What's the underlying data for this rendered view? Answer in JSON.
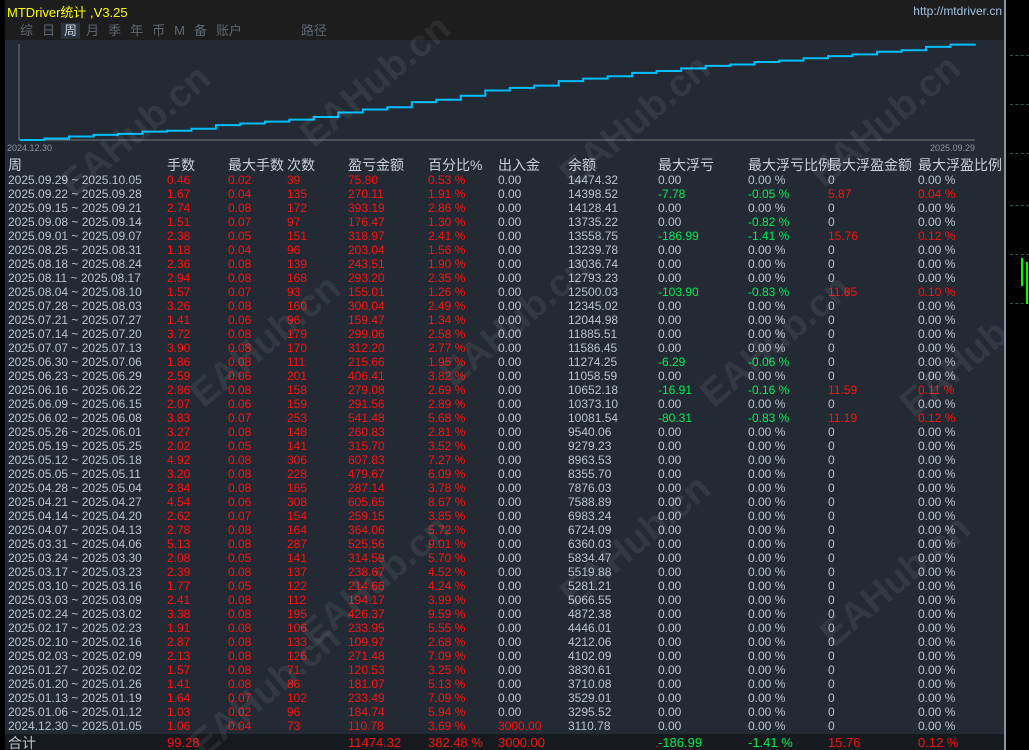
{
  "window": {
    "title": "MTDriver统计 ,V3.25",
    "url": "http://mtdriver.cn"
  },
  "tabs": [
    {
      "label": "综"
    },
    {
      "label": "日"
    },
    {
      "label": "周",
      "active": true
    },
    {
      "label": "月"
    },
    {
      "label": "季"
    },
    {
      "label": "年"
    },
    {
      "label": "币"
    },
    {
      "label": "M"
    },
    {
      "label": "备"
    },
    {
      "label": "账户"
    },
    {
      "label": "路径"
    }
  ],
  "equity_chart": {
    "start_label": "2024.12.30",
    "end_label": "2025.09.29",
    "line_color": "#00bfff"
  },
  "watermark": "EAHub.cn",
  "colors": {
    "positive": "#ff1010",
    "negative": "#00ee55",
    "text": "#b8c4d2"
  },
  "table": {
    "headers": [
      "周",
      "手数",
      "最大手数",
      "次数",
      "盈亏金额",
      "百分比%",
      "出入金",
      "余额",
      "最大浮亏",
      "最大浮亏比例",
      "最大浮盈金额",
      "最大浮盈比例"
    ],
    "rows": [
      [
        "2025.09.29 ~ 2025.10.05",
        "0.46",
        "0.02",
        "39",
        "75.80",
        "0.53 %",
        "0.00",
        "14474.32",
        "0.00",
        "0.00 %",
        "0",
        "0.00 %"
      ],
      [
        "2025.09.22 ~ 2025.09.28",
        "1.67",
        "0.04",
        "135",
        "270.11",
        "1.91 %",
        "0.00",
        "14398.52",
        "-7.78",
        "-0.05 %",
        "5.87",
        "0.04 %"
      ],
      [
        "2025.09.15 ~ 2025.09.21",
        "2.74",
        "0.08",
        "172",
        "393.19",
        "2.86 %",
        "0.00",
        "14128.41",
        "0.00",
        "0.00 %",
        "0",
        "0.00 %"
      ],
      [
        "2025.09.08 ~ 2025.09.14",
        "1.51",
        "0.07",
        "97",
        "176.47",
        "1.30 %",
        "0.00",
        "13735.22",
        "0.00",
        "-0.82 %",
        "0",
        "0.00 %"
      ],
      [
        "2025.09.01 ~ 2025.09.07",
        "2.38",
        "0.05",
        "151",
        "318.97",
        "2.41 %",
        "0.00",
        "13558.75",
        "-186.99",
        "-1.41 %",
        "15.76",
        "0.12 %"
      ],
      [
        "2025.08.25 ~ 2025.08.31",
        "1.18",
        "0.04",
        "96",
        "203.04",
        "1.56 %",
        "0.00",
        "13239.78",
        "0.00",
        "0.00 %",
        "0",
        "0.00 %"
      ],
      [
        "2025.08.18 ~ 2025.08.24",
        "2.36",
        "0.08",
        "139",
        "243.51",
        "1.90 %",
        "0.00",
        "13036.74",
        "0.00",
        "0.00 %",
        "0",
        "0.00 %"
      ],
      [
        "2025.08.11 ~ 2025.08.17",
        "2.94",
        "0.08",
        "168",
        "293.20",
        "2.35 %",
        "0.00",
        "12793.23",
        "0.00",
        "0.00 %",
        "0",
        "0.00 %"
      ],
      [
        "2025.08.04 ~ 2025.08.10",
        "1.57",
        "0.07",
        "93",
        "155.01",
        "1.26 %",
        "0.00",
        "12500.03",
        "-103.90",
        "-0.83 %",
        "11.85",
        "0.10 %"
      ],
      [
        "2025.07.28 ~ 2025.08.03",
        "3.26",
        "0.08",
        "160",
        "300.04",
        "2.49 %",
        "0.00",
        "12345.02",
        "0.00",
        "0.00 %",
        "0",
        "0.00 %"
      ],
      [
        "2025.07.21 ~ 2025.07.27",
        "1.41",
        "0.06",
        "96",
        "159.47",
        "1.34 %",
        "0.00",
        "12044.98",
        "0.00",
        "0.00 %",
        "0",
        "0.00 %"
      ],
      [
        "2025.07.14 ~ 2025.07.20",
        "3.72",
        "0.08",
        "179",
        "299.06",
        "2.58 %",
        "0.00",
        "11885.51",
        "0.00",
        "0.00 %",
        "0",
        "0.00 %"
      ],
      [
        "2025.07.07 ~ 2025.07.13",
        "3.90",
        "0.08",
        "170",
        "312.20",
        "2.77 %",
        "0.00",
        "11586.45",
        "0.00",
        "0.00 %",
        "0",
        "0.00 %"
      ],
      [
        "2025.06.30 ~ 2025.07.06",
        "1.86",
        "0.08",
        "111",
        "215.66",
        "1.95 %",
        "0.00",
        "11274.25",
        "-6.29",
        "-0.06 %",
        "0",
        "0.00 %"
      ],
      [
        "2025.06.23 ~ 2025.06.29",
        "2.59",
        "0.06",
        "201",
        "406.41",
        "3.82 %",
        "0.00",
        "11058.59",
        "0.00",
        "0.00 %",
        "0",
        "0.00 %"
      ],
      [
        "2025.06.16 ~ 2025.06.22",
        "2.86",
        "0.08",
        "158",
        "279.08",
        "2.69 %",
        "0.00",
        "10652.18",
        "-16.91",
        "-0.16 %",
        "11.59",
        "0.11 %"
      ],
      [
        "2025.06.09 ~ 2025.06.15",
        "2.07",
        "0.06",
        "159",
        "291.56",
        "2.89 %",
        "0.00",
        "10373.10",
        "0.00",
        "0.00 %",
        "0",
        "0.00 %"
      ],
      [
        "2025.06.02 ~ 2025.06.08",
        "3.83",
        "0.07",
        "253",
        "541.48",
        "5.68 %",
        "0.00",
        "10081.54",
        "-80.31",
        "-0.83 %",
        "11.19",
        "0.12 %"
      ],
      [
        "2025.05.26 ~ 2025.06.01",
        "3.27",
        "0.08",
        "148",
        "260.83",
        "2.81 %",
        "0.00",
        "9540.06",
        "0.00",
        "0.00 %",
        "0",
        "0.00 %"
      ],
      [
        "2025.05.19 ~ 2025.05.25",
        "2.02",
        "0.05",
        "141",
        "315.70",
        "3.52 %",
        "0.00",
        "9279.23",
        "0.00",
        "0.00 %",
        "0",
        "0.00 %"
      ],
      [
        "2025.05.12 ~ 2025.05.18",
        "4.92",
        "0.08",
        "306",
        "607.83",
        "7.27 %",
        "0.00",
        "8963.53",
        "0.00",
        "0.00 %",
        "0",
        "0.00 %"
      ],
      [
        "2025.05.05 ~ 2025.05.11",
        "3.20",
        "0.08",
        "228",
        "479.67",
        "6.09 %",
        "0.00",
        "8355.70",
        "0.00",
        "0.00 %",
        "0",
        "0.00 %"
      ],
      [
        "2025.04.28 ~ 2025.05.04",
        "2.84",
        "0.08",
        "165",
        "287.14",
        "3.78 %",
        "0.00",
        "7876.03",
        "0.00",
        "0.00 %",
        "0",
        "0.00 %"
      ],
      [
        "2025.04.21 ~ 2025.04.27",
        "4.54",
        "0.06",
        "308",
        "605.65",
        "8.67 %",
        "0.00",
        "7588.89",
        "0.00",
        "0.00 %",
        "0",
        "0.00 %"
      ],
      [
        "2025.04.14 ~ 2025.04.20",
        "2.62",
        "0.07",
        "154",
        "259.15",
        "3.85 %",
        "0.00",
        "6983.24",
        "0.00",
        "0.00 %",
        "0",
        "0.00 %"
      ],
      [
        "2025.04.07 ~ 2025.04.13",
        "2.78",
        "0.08",
        "164",
        "364.06",
        "5.72 %",
        "0.00",
        "6724.09",
        "0.00",
        "0.00 %",
        "0",
        "0.00 %"
      ],
      [
        "2025.03.31 ~ 2025.04.06",
        "5.13",
        "0.08",
        "287",
        "525.56",
        "9.01 %",
        "0.00",
        "6360.03",
        "0.00",
        "0.00 %",
        "0",
        "0.00 %"
      ],
      [
        "2025.03.24 ~ 2025.03.30",
        "2.08",
        "0.05",
        "141",
        "314.59",
        "5.70 %",
        "0.00",
        "5834.47",
        "0.00",
        "0.00 %",
        "0",
        "0.00 %"
      ],
      [
        "2025.03.17 ~ 2025.03.23",
        "2.39",
        "0.08",
        "137",
        "238.67",
        "4.52 %",
        "0.00",
        "5519.88",
        "0.00",
        "0.00 %",
        "0",
        "0.00 %"
      ],
      [
        "2025.03.10 ~ 2025.03.16",
        "1.77",
        "0.05",
        "122",
        "214.66",
        "4.24 %",
        "0.00",
        "5281.21",
        "0.00",
        "0.00 %",
        "0",
        "0.00 %"
      ],
      [
        "2025.03.03 ~ 2025.03.09",
        "2.41",
        "0.08",
        "112",
        "194.17",
        "3.99 %",
        "0.00",
        "5066.55",
        "0.00",
        "0.00 %",
        "0",
        "0.00 %"
      ],
      [
        "2025.02.24 ~ 2025.03.02",
        "3.38",
        "0.08",
        "195",
        "426.37",
        "9.59 %",
        "0.00",
        "4872.38",
        "0.00",
        "0.00 %",
        "0",
        "0.00 %"
      ],
      [
        "2025.02.17 ~ 2025.02.23",
        "1.91",
        "0.08",
        "106",
        "233.95",
        "5.55 %",
        "0.00",
        "4446.01",
        "0.00",
        "0.00 %",
        "0",
        "0.00 %"
      ],
      [
        "2025.02.10 ~ 2025.02.16",
        "2.87",
        "0.08",
        "133",
        "109.97",
        "2.68 %",
        "0.00",
        "4212.06",
        "0.00",
        "0.00 %",
        "0",
        "0.00 %"
      ],
      [
        "2025.02.03 ~ 2025.02.09",
        "2.13",
        "0.08",
        "126",
        "271.48",
        "7.09 %",
        "0.00",
        "4102.09",
        "0.00",
        "0.00 %",
        "0",
        "0.00 %"
      ],
      [
        "2025.01.27 ~ 2025.02.02",
        "1.57",
        "0.08",
        "71",
        "120.53",
        "3.25 %",
        "0.00",
        "3830.61",
        "0.00",
        "0.00 %",
        "0",
        "0.00 %"
      ],
      [
        "2025.01.20 ~ 2025.01.26",
        "1.41",
        "0.08",
        "86",
        "181.07",
        "5.13 %",
        "0.00",
        "3710.08",
        "0.00",
        "0.00 %",
        "0",
        "0.00 %"
      ],
      [
        "2025.01.13 ~ 2025.01.19",
        "1.64",
        "0.07",
        "102",
        "233.49",
        "7.09 %",
        "0.00",
        "3529.01",
        "0.00",
        "0.00 %",
        "0",
        "0.00 %"
      ],
      [
        "2025.01.06 ~ 2025.01.12",
        "1.03",
        "0.02",
        "96",
        "184.74",
        "5.94 %",
        "0.00",
        "3295.52",
        "0.00",
        "0.00 %",
        "0",
        "0.00 %"
      ],
      [
        "2024.12.30 ~ 2025.01.05",
        "1.06",
        "0.04",
        "73",
        "110.78",
        "3.69 %",
        "3000.00",
        "3110.78",
        "0.00",
        "0.00 %",
        "0",
        "0.00 %"
      ]
    ],
    "total": [
      "合计",
      "99.28",
      "",
      "",
      "11474.32",
      "382.48 %",
      "3000.00",
      "",
      "-186.99",
      "-1.41 %",
      "15.76",
      "0.12 %"
    ]
  }
}
